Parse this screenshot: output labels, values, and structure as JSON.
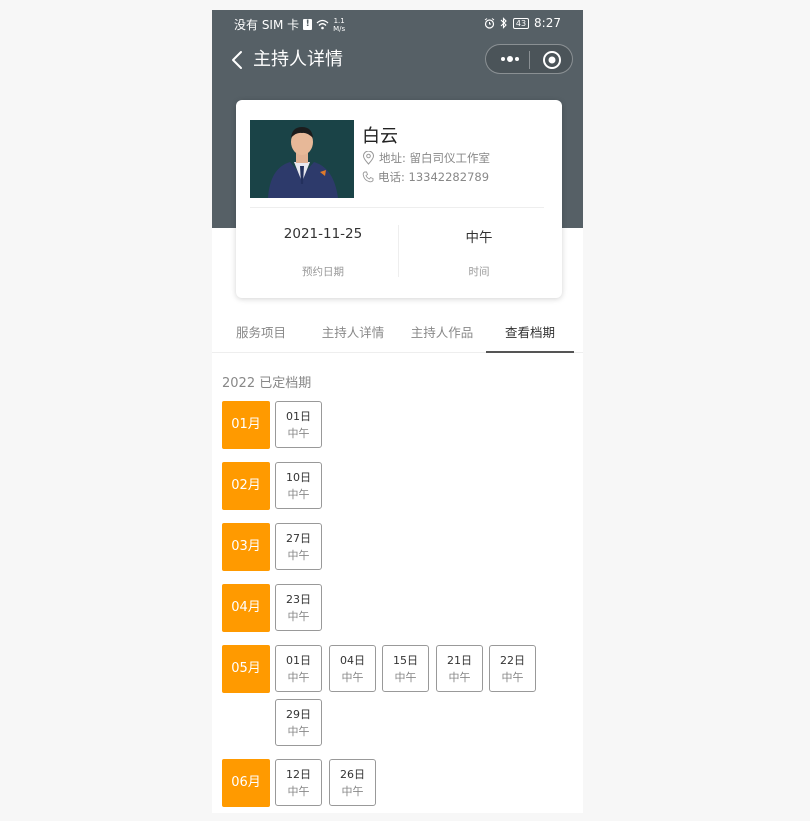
{
  "status_bar": {
    "carrier": "没有 SIM 卡",
    "sim_alert": "!",
    "speed_value": "1.1",
    "speed_unit": "M/s",
    "battery": "43",
    "time": "8:27"
  },
  "nav": {
    "title": "主持人详情"
  },
  "host": {
    "name": "白云",
    "address": "地址:  留白司仪工作室",
    "phone": "电话:  13342282789",
    "date_value": "2021-11-25",
    "date_label": "预约日期",
    "time_value": "中午",
    "time_label": "时间"
  },
  "tabs": [
    {
      "label": "服务项目"
    },
    {
      "label": "主持人详情"
    },
    {
      "label": "主持人作品"
    },
    {
      "label": "查看档期"
    }
  ],
  "schedule": {
    "year_title": "2022 已定档期",
    "months": [
      {
        "month": "01月",
        "days": [
          {
            "day": "01日",
            "period": "中午"
          }
        ]
      },
      {
        "month": "02月",
        "days": [
          {
            "day": "10日",
            "period": "中午"
          }
        ]
      },
      {
        "month": "03月",
        "days": [
          {
            "day": "27日",
            "period": "中午"
          }
        ]
      },
      {
        "month": "04月",
        "days": [
          {
            "day": "23日",
            "period": "中午"
          }
        ]
      },
      {
        "month": "05月",
        "days": [
          {
            "day": "01日",
            "period": "中午"
          },
          {
            "day": "04日",
            "period": "中午"
          },
          {
            "day": "15日",
            "period": "中午"
          },
          {
            "day": "21日",
            "period": "中午"
          },
          {
            "day": "22日",
            "period": "中午"
          },
          {
            "day": "29日",
            "period": "中午"
          }
        ]
      },
      {
        "month": "06月",
        "days": [
          {
            "day": "12日",
            "period": "中午"
          },
          {
            "day": "26日",
            "period": "中午"
          }
        ]
      }
    ]
  },
  "colors": {
    "header": "#566066",
    "month_badge": "#ff9a00",
    "active_tab_underline": "#555555"
  },
  "icons": {
    "back": "chevron-left-icon",
    "more": "more-dots-icon",
    "close": "target-circle-icon",
    "address": "location-pin-icon",
    "phone": "phone-icon"
  }
}
